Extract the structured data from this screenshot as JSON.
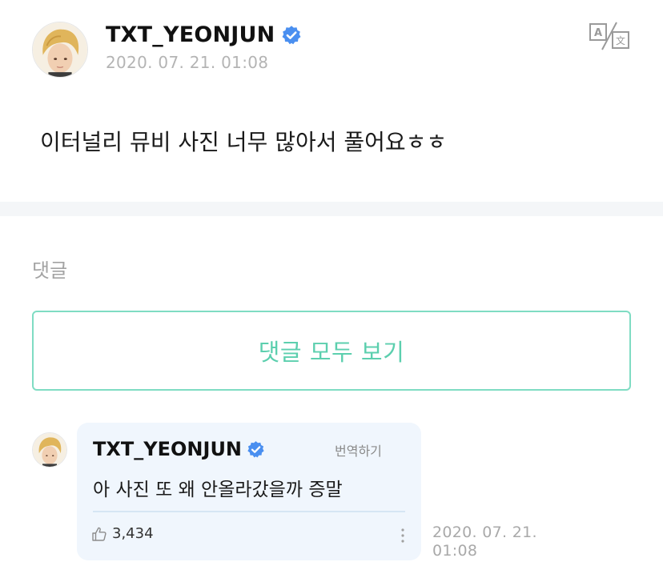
{
  "post": {
    "author": "TXT_YEONJUN",
    "verified_icon": "verified-badge-icon",
    "date": "2020. 07. 21. 01:08",
    "translate_icon": "translate-icon",
    "body": "이터널리 뮤비 사진 너무 많아서 풀어요ㅎㅎ"
  },
  "comments": {
    "title": "댓글",
    "view_all_label": "댓글 모두 보기",
    "items": [
      {
        "author": "TXT_YEONJUN",
        "translate_label": "번역하기",
        "text": "아 사진 또 왜 안올라갔을까 증말",
        "likes": "3,434",
        "date_line1": "2020. 07. 21.",
        "date_line2": "01:08"
      }
    ]
  },
  "colors": {
    "accent": "#5ccfae",
    "accent_border": "#7fdcc3",
    "verified": "#4a8ff0",
    "comment_bubble": "#f0f6fd",
    "divider": "#f4f6f8",
    "muted_text": "#b4b4b4"
  }
}
